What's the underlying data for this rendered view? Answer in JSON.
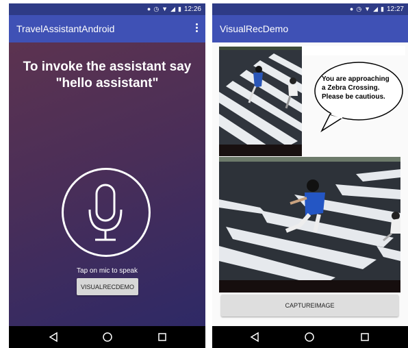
{
  "left_app": {
    "status_time": "12:26",
    "title": "TravelAssistantAndroid",
    "invoke_line1": "To invoke the assistant say",
    "invoke_line2": "\"hello assistant\"",
    "tap_hint": "Tap on mic to speak",
    "button_label": "VISUALRECDEMO"
  },
  "right_app": {
    "status_time": "12:27",
    "title": "VisualRecDemo",
    "bubble_line1": "You are approaching",
    "bubble_line2": "a Zebra Crossing.",
    "bubble_line3": "Please be cautious.",
    "button_label": "CAPTUREIMAGE"
  },
  "colors": {
    "app_bar": "#3f51b5",
    "status_bar": "#2e3b86",
    "gradient_top": "#5c3350",
    "gradient_bottom": "#2e2966"
  },
  "icons": [
    "location-icon",
    "alarm-icon",
    "wifi-icon",
    "signal-icon",
    "battery-icon",
    "overflow-menu-icon",
    "microphone-icon",
    "nav-back-icon",
    "nav-home-icon",
    "nav-recents-icon"
  ]
}
